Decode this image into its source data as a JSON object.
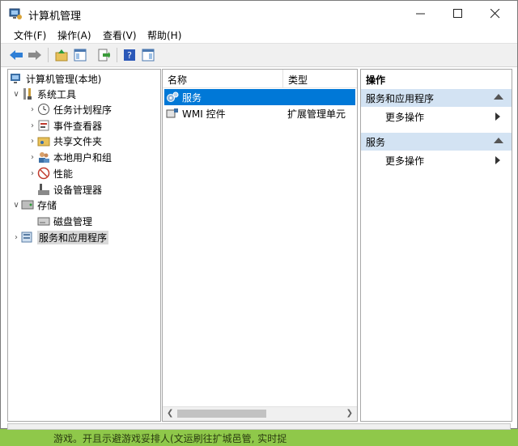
{
  "window": {
    "title": "计算机管理"
  },
  "menu": [
    "文件(F)",
    "操作(A)",
    "查看(V)",
    "帮助(H)"
  ],
  "tree": {
    "root": "计算机管理(本地)",
    "system_tools": "系统工具",
    "task_scheduler": "任务计划程序",
    "event_viewer": "事件查看器",
    "shared_folders": "共享文件夹",
    "local_users": "本地用户和组",
    "performance": "性能",
    "device_manager": "设备管理器",
    "storage": "存储",
    "disk_management": "磁盘管理",
    "services_apps": "服务和应用程序"
  },
  "list": {
    "col_name": "名称",
    "col_type": "类型",
    "rows": [
      {
        "name": "服务",
        "type": ""
      },
      {
        "name": "WMI 控件",
        "type": "扩展管理单元"
      }
    ]
  },
  "actions": {
    "header": "操作",
    "section1": "服务和应用程序",
    "more1": "更多操作",
    "section2": "服务",
    "more2": "更多操作"
  },
  "background_text": "游戏。开且示避游戏妥排人(文运刷往扩城邑管, 实时捉",
  "colors": {
    "selection": "#0078d7",
    "action_section": "#d3e3f3"
  }
}
